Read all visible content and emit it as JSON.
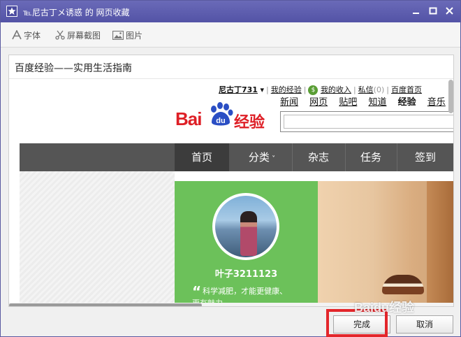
{
  "window": {
    "title": "℡尼古丁メ诱惑 的 网页收藏",
    "accent": "#5a5aa8"
  },
  "toolbar": {
    "font_label": "字体",
    "screenshot_label": "屏幕截图",
    "image_label": "图片"
  },
  "content": {
    "page_title": "百度经验——实用生活指南",
    "userbar": {
      "username": "尼古丁731",
      "my_experience": "我的经验",
      "my_income": "我的收入",
      "messages": "私信",
      "message_count": "(0)",
      "baidu_home": "百度首页"
    },
    "nav_links": [
      "新闻",
      "网页",
      "贴吧",
      "知道",
      "经验",
      "音乐"
    ],
    "logo": {
      "bai": "Bai",
      "du": "du",
      "cn": "经验",
      "color": "#de1f26"
    },
    "menu": {
      "home": "首页",
      "category": "分类",
      "magazine": "杂志",
      "task": "任务",
      "sign": "签到"
    },
    "profile": {
      "name": "叶子3211123",
      "quote": "科学减肥，才能更健康、",
      "quote_cont": "更有魅力"
    }
  },
  "buttons": {
    "done": "完成",
    "cancel": "取消"
  },
  "watermark": "Baidu经验"
}
